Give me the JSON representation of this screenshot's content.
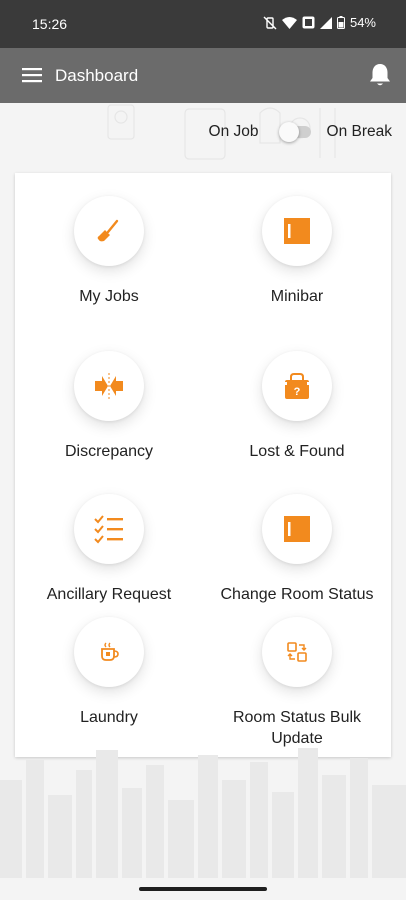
{
  "status_bar": {
    "time": "15:26",
    "battery": "54%"
  },
  "header": {
    "title": "Dashboard"
  },
  "shift_toggle": {
    "left_label": "On Job",
    "right_label": "On Break"
  },
  "tiles": [
    {
      "label": "My Jobs",
      "icon": "broom-icon"
    },
    {
      "label": "Minibar",
      "icon": "minibar-icon"
    },
    {
      "label": "Discrepancy",
      "icon": "discrepancy-icon"
    },
    {
      "label": "Lost & Found",
      "icon": "lost-found-icon"
    },
    {
      "label": "Ancillary Request",
      "icon": "checklist-icon"
    },
    {
      "label": "Change Room Status",
      "icon": "room-status-icon"
    },
    {
      "label": "Laundry",
      "icon": "laundry-icon"
    },
    {
      "label": "Room Status Bulk Update",
      "icon": "bulk-update-icon"
    }
  ],
  "colors": {
    "accent": "#f28a1e",
    "app_bar": "#6b6b6b",
    "status_bar": "#3a3a3a"
  }
}
